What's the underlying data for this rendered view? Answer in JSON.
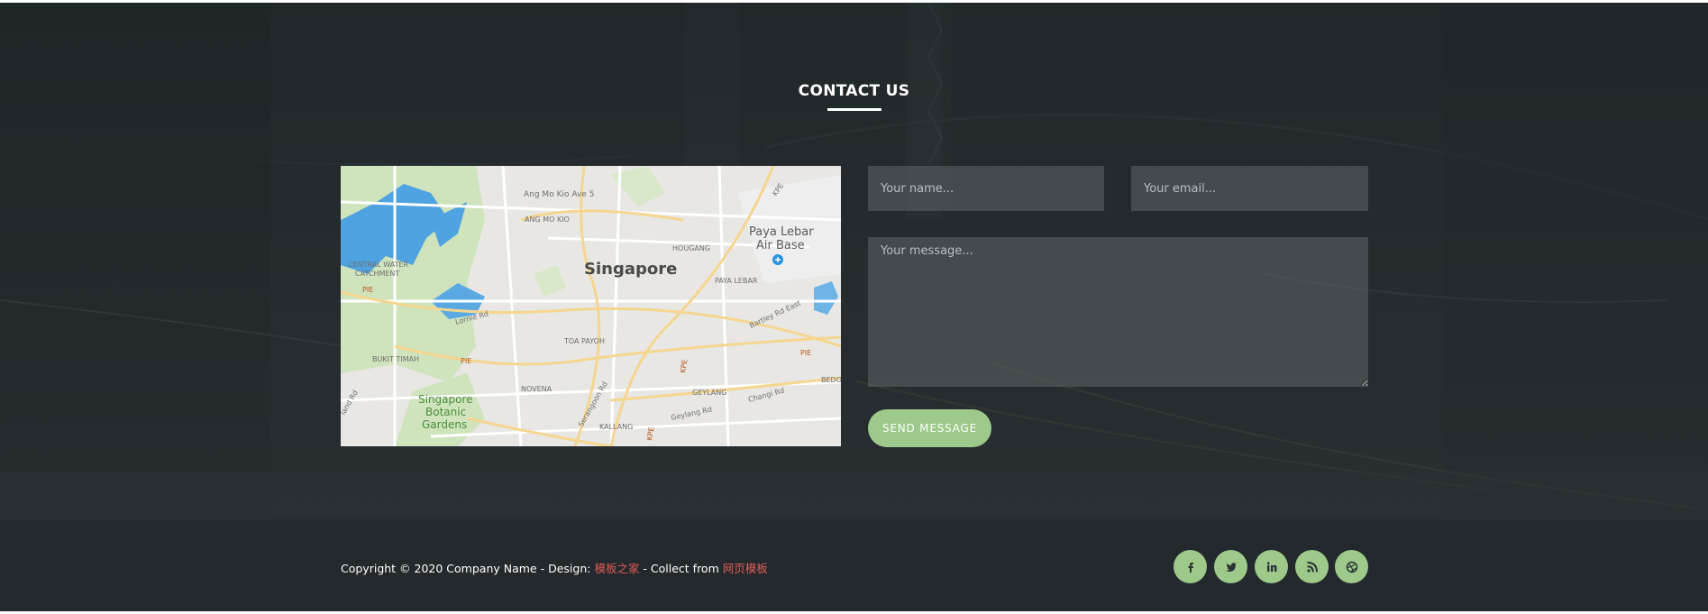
{
  "contact": {
    "title": "CONTACT US",
    "map": {
      "labels": {
        "city": "Singapore",
        "air_base_line1": "Paya Lebar",
        "air_base_line2": "Air Base",
        "ang_mo_kio_ave": "Ang Mo Kio Ave 5",
        "ang_mo_kio": "ANG MO KIO",
        "kpe_top": "KPE",
        "hougang": "HOUGANG",
        "catchment_line1": "CENTRAL WATER",
        "catchment_line2": "CATCHMENT",
        "paya_lebar": "PAYA LEBAR",
        "pie_left": "PIE",
        "lornie": "Lornie Rd",
        "bartley": "Bartley Rd East",
        "toa_payoh": "TOA PAYOH",
        "bukit_timah": "BUKIT TIMAH",
        "pie_mid": "PIE",
        "pie_right": "PIE",
        "kpe_mid": "KPE",
        "bedok": "BEDO",
        "novena": "NOVENA",
        "serangoon": "Serangoon Rd",
        "geylang": "GEYLANG",
        "changi": "Changi Rd",
        "gardens_line1": "Singapore",
        "gardens_line2": "Botanic",
        "gardens_line3": "Gardens",
        "geylang_rd": "Geylang Rd",
        "kallang": "KALLANG",
        "kpe_bottom": "KPE",
        "farrer": "land Rd"
      }
    },
    "form": {
      "name_placeholder": "Your name...",
      "email_placeholder": "Your email...",
      "message_placeholder": "Your message...",
      "send_label": "SEND MESSAGE"
    }
  },
  "footer": {
    "copyright_text": "Copyright © 2020 Company Name - Design: ",
    "design_link": "模板之家",
    "collect_text": " - Collect from ",
    "collect_link": "网页模板",
    "social": [
      {
        "icon": "facebook-icon"
      },
      {
        "icon": "twitter-icon"
      },
      {
        "icon": "linkedin-icon"
      },
      {
        "icon": "rss-icon"
      },
      {
        "icon": "dribbble-icon"
      }
    ]
  },
  "colors": {
    "accent": "#9dc98a",
    "footer_bg": "#23292c",
    "link": "#e05a5a"
  }
}
